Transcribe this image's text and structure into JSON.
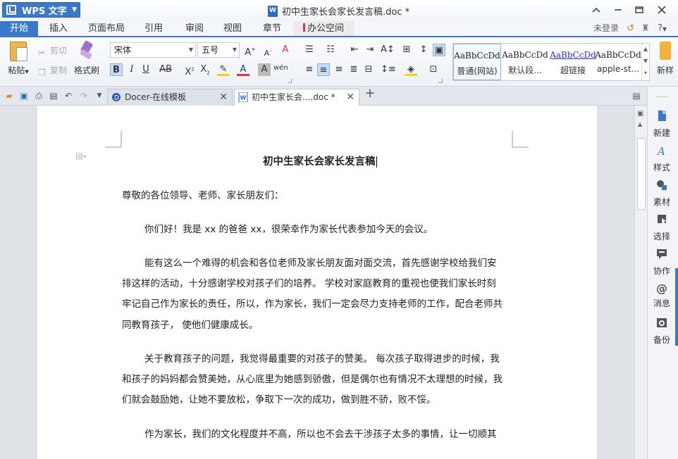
{
  "titlebar": {
    "app_name": "WPS 文字",
    "doc_title": "初中生家长会家长发言稿.doc *"
  },
  "menu": {
    "items": [
      "开始",
      "插入",
      "页面布局",
      "引用",
      "审阅",
      "视图",
      "章节",
      "办公空间"
    ],
    "active": "开始",
    "login": "未登录",
    "help": "?"
  },
  "ribbon": {
    "paste": "粘贴",
    "cut": "剪切",
    "copy": "复制",
    "format_painter": "格式刷",
    "font_name": "宋体",
    "font_size": "五号",
    "styles": [
      {
        "sample": "AaBbCcDd",
        "name": "普通(网站)"
      },
      {
        "sample": "AaBbCcDd",
        "name": "默认段..."
      },
      {
        "sample": "AaBbCcDd",
        "name": "超链接"
      },
      {
        "sample": "AaBbCcDd",
        "name": "apple-st..."
      }
    ],
    "new_style": "新样"
  },
  "tabs": {
    "docer": "Docer-在线模板",
    "document": "初中生家长会....doc *",
    "add": "+"
  },
  "document": {
    "title": "初中生家长会家长发言稿",
    "lines": [
      "尊敬的各位领导、老师、家长朋友们：",
      "你们好！我是 xx 的爸爸 xx，很荣幸作为家长代表参加今天的会议。",
      "能有这么一个难得的机会和各位老师及家长朋友面对面交流，首先感谢学校给我们安",
      "排这样的活动，十分感谢学校对孩子们的培养。 学校对家庭教育的重视也使我们家长时刻",
      "牢记自己作为家长的责任，所以，作为家长，我们一定会尽力支持老师的工作，配合老师共",
      "同教育孩子， 使他们健康成长。",
      "关于教育孩子的问题，我觉得最重要的对孩子的赞美。 每次孩子取得进步的时候，我",
      "和孩子的妈妈都会赞美她，从心底里为她感到骄傲，但是偶尔也有情况不太理想的时候，我",
      "们就会鼓励她，让她不要放松，争取下一次的成功，做到胜不骄，败不馁。",
      "作为家长，我们的文化程度并不高，所以也不会去干涉孩子太多的事情，让一切顺其"
    ]
  },
  "sidepanel": {
    "items": [
      "新建",
      "样式",
      "素材",
      "选择",
      "协作",
      "消息",
      "备份"
    ]
  },
  "colors": {
    "accent": "#3b79c8",
    "office_marker": "#d8344a"
  }
}
